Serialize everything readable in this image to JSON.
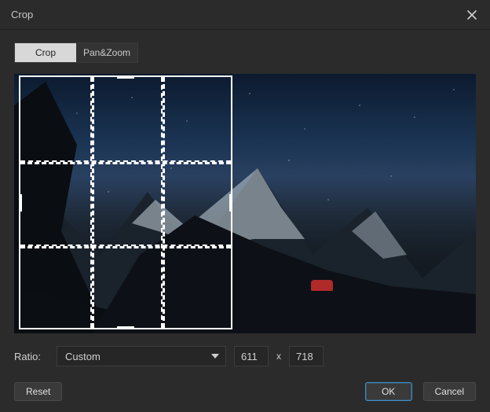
{
  "window": {
    "title": "Crop"
  },
  "tabs": {
    "crop": "Crop",
    "panzoom": "Pan&Zoom",
    "active": "crop"
  },
  "ratio": {
    "label": "Ratio:",
    "selected": "Custom",
    "width": "611",
    "separator": "x",
    "height": "718"
  },
  "buttons": {
    "reset": "Reset",
    "ok": "OK",
    "cancel": "Cancel"
  }
}
